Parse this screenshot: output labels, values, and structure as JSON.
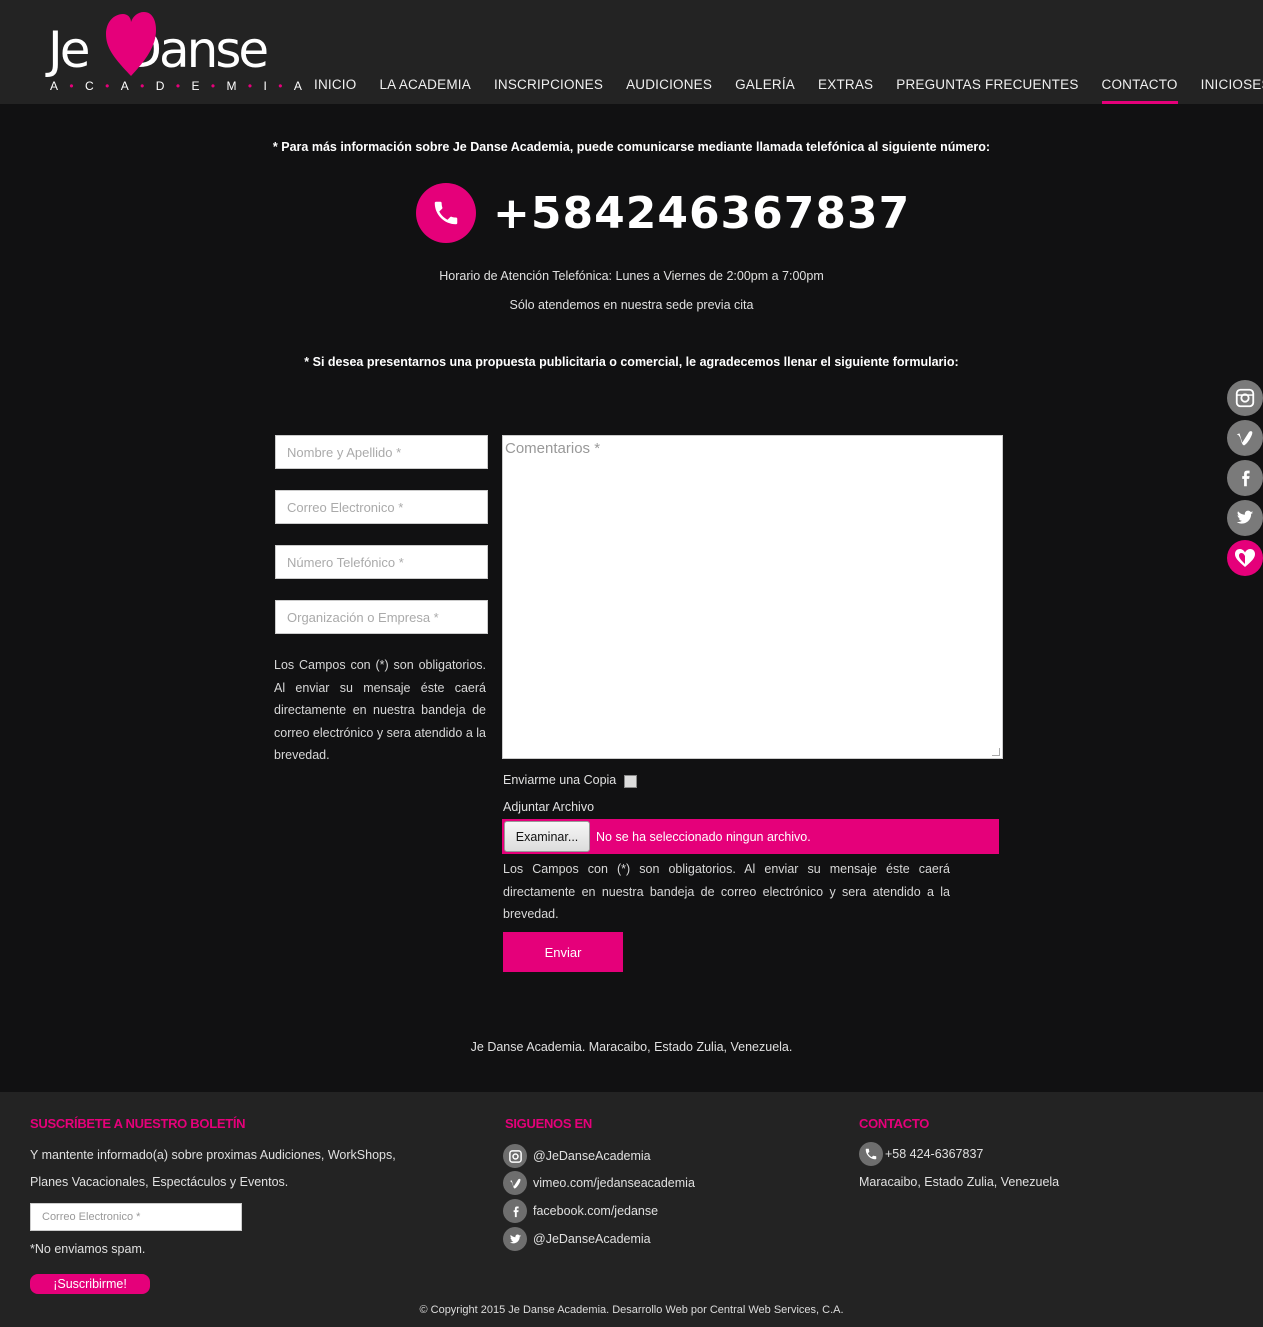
{
  "logo": {
    "main_left": "Je",
    "main_right": "Danse",
    "sub_letters": [
      "A",
      "C",
      "A",
      "D",
      "E",
      "M",
      "I",
      "A"
    ]
  },
  "nav": {
    "items": [
      "INICIO",
      "LA ACADEMIA",
      "INSCRIPCIONES",
      "AUDICIONES",
      "GALERÍA",
      "EXTRAS",
      "PREGUNTAS FRECUENTES",
      "CONTACTO",
      "INICIOSESION"
    ],
    "active": "CONTACTO"
  },
  "contact": {
    "intro": "* Para más información sobre Je Danse Academia, puede comunicarse mediante llamada telefónica al siguiente número:",
    "phone": "+584246367837",
    "hours": "Horario de Atención Telefónica: Lunes a Viernes de 2:00pm a 7:00pm",
    "appointment": "Sólo atendemos en nuestra sede previa cita",
    "form_intro": "* Si desea presentarnos una propuesta publicitaria o comercial, le agradecemos llenar el siguiente formulario:"
  },
  "form": {
    "name_placeholder": "Nombre y Apellido *",
    "email_placeholder": "Correo Electronico *",
    "phone_placeholder": "Número Telefónico *",
    "org_placeholder": "Organización o Empresa *",
    "comments_placeholder": "Comentarios *",
    "required_note": "Los Campos con (*) son obligatorios. Al enviar su mensaje éste caerá directamente en nuestra bandeja de correo electrónico y sera atendido a la brevedad.",
    "copy_label": "Enviarme una Copia",
    "attach_label": "Adjuntar Archivo",
    "file_button": "Examinar...",
    "file_status": "No se ha seleccionado ningun archivo.",
    "submit": "Enviar"
  },
  "address": "Je Danse Academia. Maracaibo, Estado Zulia, Venezuela.",
  "social_sidebar": [
    "instagram-icon",
    "vimeo-icon",
    "facebook-icon",
    "twitter-icon",
    "heart-icon"
  ],
  "footer": {
    "newsletter": {
      "title": "SUSCRÍBETE A NUESTRO BOLETÍN",
      "text_line1": "Y mantente informado(a) sobre proximas Audiciones, WorkShops,",
      "text_line2": "Planes Vacacionales, Espectáculos y Eventos.",
      "email_placeholder": "Correo Electronico *",
      "spam": "*No enviamos spam.",
      "button": "¡Suscribirme!"
    },
    "follow": {
      "title": "SIGUENOS EN",
      "links": [
        {
          "icon": "instagram-icon",
          "text": "@JeDanseAcademia"
        },
        {
          "icon": "vimeo-icon",
          "text": "vimeo.com/jedanseacademia"
        },
        {
          "icon": "facebook-icon",
          "text": "facebook.com/jedanse"
        },
        {
          "icon": "twitter-icon",
          "text": "@JeDanseAcademia"
        }
      ]
    },
    "contact": {
      "title": "CONTACTO",
      "phone": "+58 424-6367837",
      "location": "Maracaibo, Estado Zulia, Venezuela"
    },
    "copyright": "© Copyright 2015 Je Danse Academia. Desarrollo Web por Central Web Services, C.A."
  },
  "colors": {
    "accent": "#e5007a",
    "header_bg": "#232323",
    "body_bg": "#111112"
  }
}
